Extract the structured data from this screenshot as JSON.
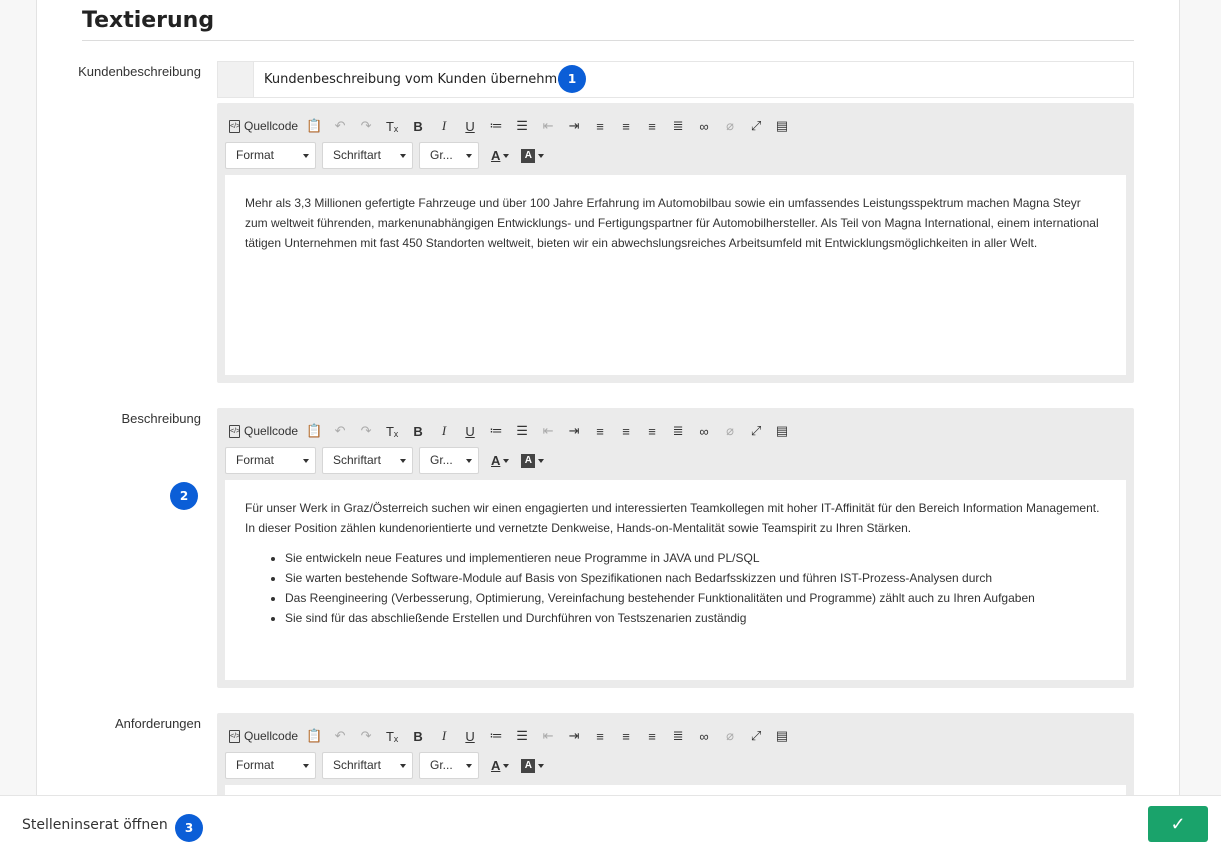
{
  "section": {
    "title": "Textierung"
  },
  "customer_description": {
    "label": "Kundenbeschreibung",
    "checkbox_label": "Kundenbeschreibung vom Kunden übernehmen",
    "badge": "1",
    "paragraphs": [
      "Mehr als 3,3 Millionen gefertigte Fahrzeuge und über 100 Jahre Erfahrung im Automobilbau sowie ein umfassendes Leistungsspektrum machen Magna Steyr zum weltweit führenden, markenunabhängigen Entwicklungs- und Fertigungspartner für Automobilhersteller. Als Teil von Magna International, einem international tätigen Unternehmen mit fast 450 Standorten weltweit, bieten wir ein abwechslungsreiches Arbeitsumfeld mit Entwicklungsmöglichkeiten in aller Welt."
    ]
  },
  "description": {
    "label": "Beschreibung",
    "badge": "2",
    "intro": "Für unser Werk in Graz/Österreich suchen wir einen engagierten und interessierten Teamkollegen mit hoher IT-Affinität für den Bereich Information Management. In dieser Position zählen kundenorientierte und vernetzte Denkweise, Hands-on-Mentalität sowie Teamspirit zu Ihren Stärken.",
    "bullets": [
      "Sie entwickeln neue Features und implementieren neue Programme in JAVA und PL/SQL",
      "Sie warten bestehende Software-Module auf Basis von Spezifikationen nach Bedarfsskizzen und führen IST-Prozess-Analysen durch",
      "Das Reengineering (Verbesserung, Optimierung, Vereinfachung bestehender Funktionalitäten und Programme) zählt auch zu Ihren Aufgaben",
      "Sie sind für das abschließende Erstellen und Durchführen von Testszenarien zuständig"
    ]
  },
  "requirements": {
    "label": "Anforderungen"
  },
  "toolbar": {
    "source_label": "Quellcode",
    "format_label": "Format",
    "font_label": "Schriftart",
    "size_label": "Gr...",
    "icons": [
      "paste-text-icon",
      "undo-icon",
      "redo-icon",
      "remove-format-icon",
      "bold-icon",
      "italic-icon",
      "underline-icon",
      "numbered-list-icon",
      "bulleted-list-icon",
      "outdent-icon",
      "indent-icon",
      "align-left-icon",
      "align-center-icon",
      "align-right-icon",
      "justify-icon",
      "link-icon",
      "unlink-icon",
      "maximize-icon",
      "show-blocks-icon"
    ]
  },
  "footer": {
    "open_ad_label": "Stelleninserat öffnen",
    "badge": "3",
    "save_icon": "check-icon",
    "save_color": "#1aa36b"
  },
  "colors": {
    "badge": "#0b5ed7",
    "editor_bg": "#ebebeb"
  }
}
